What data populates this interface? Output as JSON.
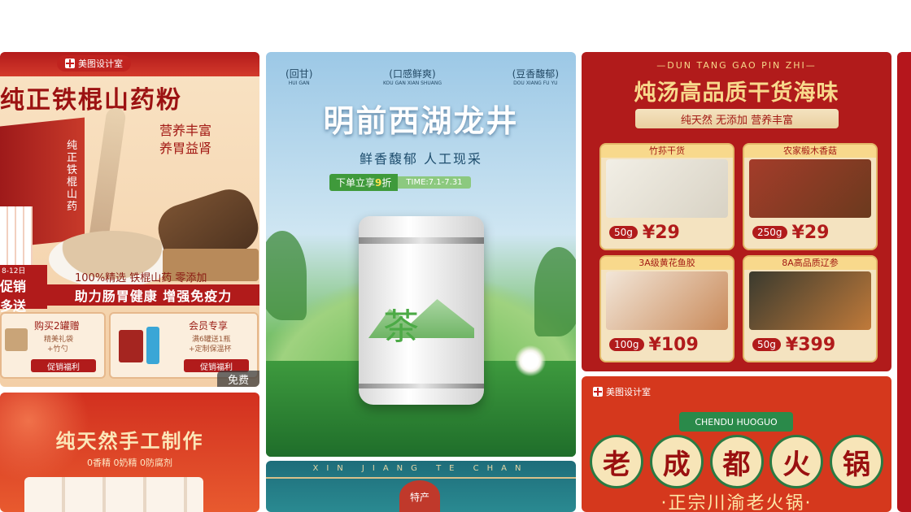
{
  "cards": {
    "c1": {
      "brand": "美图设计室",
      "title": "纯正铁棍山药粉",
      "tagline1": "营养丰富",
      "tagline2": "养胃益肾",
      "box_text": "纯正铁棍山药",
      "features": "100%精选 铁棍山药 零添加",
      "slogan": "助力肠胃健康 增强免疫力",
      "promo_left_date": "8-12日",
      "promo_left_1": "促销",
      "promo_left_2": "多送",
      "offer1_title": "购买2罐赠",
      "offer1_sub1": "精美礼袋",
      "offer1_sub2": "+竹勺",
      "offer1_btn": "促销福利",
      "offer2_title": "会员专享",
      "offer2_sub1": "满6罐送1瓶",
      "offer2_sub2": "+定制保温杯",
      "offer2_btn": "促销福利",
      "free": "免费"
    },
    "c2": {
      "pill1": "回甘",
      "pill1_sub": "HUI GAN",
      "pill2": "口感鲜爽",
      "pill2_sub": "KOU GAN XIAN SHUANG",
      "pill3": "豆香馥郁",
      "pill3_sub": "DOU XIANG FU YU",
      "title": "明前西湖龙井",
      "subtitle": "鲜香馥郁 人工现采",
      "promo_a": "下单立享",
      "promo_num": "9",
      "promo_b": "折",
      "time": "TIME:7.1-7.31",
      "can_text": "茶"
    },
    "c3": {
      "pinyin": "DUN TANG GAO PIN ZHI",
      "title": "炖汤高品质干货海味",
      "ribbon": "纯天然 无添加 营养丰富",
      "items": [
        {
          "name": "竹荪干货",
          "weight": "50g",
          "price": "¥29"
        },
        {
          "name": "农家椴木香菇",
          "weight": "250g",
          "price": "¥29"
        },
        {
          "name": "3A级黄花鱼胶",
          "weight": "100g",
          "price": "¥109"
        },
        {
          "name": "8A高品质辽参",
          "weight": "50g",
          "price": "¥399"
        }
      ]
    },
    "c4": {
      "title": "纯天然手工制作",
      "sub": "0香精  0奶精  0防腐剂"
    },
    "c5": {
      "pinyin": "XIN JIANG TE CHAN",
      "badge": "特产"
    },
    "c6": {
      "brand": "美图设计室",
      "pinyin": "CHENDU HUOGUO",
      "chars": [
        "老",
        "成",
        "都",
        "火",
        "锅"
      ],
      "sub": "·正宗川渝老火锅·"
    }
  },
  "colors": {
    "red": "#b11b1b",
    "gold": "#f7d98a",
    "green": "#2e8a3b"
  }
}
